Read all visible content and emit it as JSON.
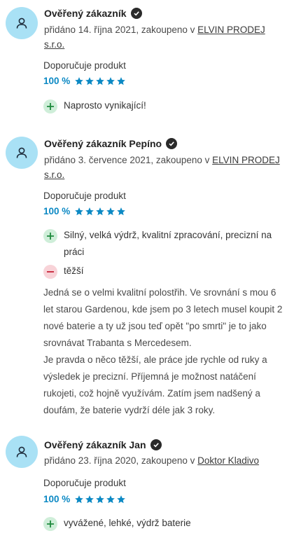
{
  "reviews": [
    {
      "author": "Ověřený zákazník",
      "meta_prefix": "přidáno 14. října 2021, zakoupeno v ",
      "shop": "ELVIN PRODEJ s.r.o.",
      "recommend": "Doporučuje produkt",
      "percent": "100 %",
      "stars": 5,
      "pros": [
        "Naprosto vynikající!"
      ],
      "cons": [],
      "text": ""
    },
    {
      "author": "Ověřený zákazník Pepíno",
      "meta_prefix": "přidáno 3. července 2021, zakoupeno v ",
      "shop": "ELVIN PRODEJ s.r.o.",
      "recommend": "Doporučuje produkt",
      "percent": "100 %",
      "stars": 5,
      "pros": [
        "Silný, velká výdrž, kvalitní zpracování, precizní na práci"
      ],
      "cons": [
        "těžší"
      ],
      "text_p1": "Jedná se o velmi kvalitní polostřih. Ve srovnání s mou 6 let starou Gardenou, kde jsem po 3 letech musel koupit 2 nové baterie a ty už jsou teď opět \"po smrti\" je to jako srovnávat Trabanta s Mercedesem.",
      "text_p2": "Je pravda o něco těžší, ale práce jde rychle od ruky a výsledek je precizní. Příjemná je možnost natáčení rukojeti, což hojně využívám. Zatím jsem nadšený a doufám, že baterie vydrží déle jak 3 roky."
    },
    {
      "author": "Ověřený zákazník Jan",
      "meta_prefix": "přidáno 23. října 2020, zakoupeno v ",
      "shop": "Doktor Kladivo",
      "recommend": "Doporučuje produkt",
      "percent": "100 %",
      "stars": 5,
      "pros": [
        "vyvážené, lehké, výdrž baterie"
      ],
      "cons": [],
      "text": ""
    }
  ],
  "colors": {
    "accent": "#0c89c4",
    "avatar_bg": "#a9e1f5",
    "pro_bg": "#cfeed9",
    "con_bg": "#f8d3d8"
  }
}
